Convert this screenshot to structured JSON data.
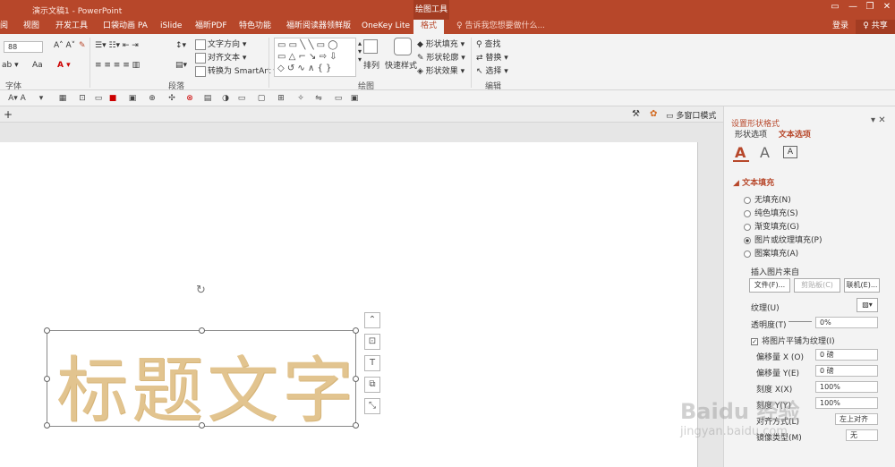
{
  "title_bar": {
    "title": "演示文稿1 - PowerPoint",
    "context_tool": "绘图工具",
    "buttons": [
      "▭",
      "—",
      "❐",
      "✕"
    ]
  },
  "tabs": [
    {
      "label": "阅"
    },
    {
      "label": "视图"
    },
    {
      "label": "开发工具"
    },
    {
      "label": "口袋动画 PA"
    },
    {
      "label": "iSlide"
    },
    {
      "label": "福昕PDF"
    },
    {
      "label": "特色功能"
    },
    {
      "label": "福昕阅读器领鲜版"
    },
    {
      "label": "OneKey Lite"
    },
    {
      "label": "格式"
    }
  ],
  "tell_me": "♀ 告诉我您想要做什么...",
  "login": "登录",
  "share": "♀ 共享",
  "ribbon": {
    "font_size": "88",
    "font_label": "字体",
    "paragraph_label": "段落",
    "text_direction": "文字方向",
    "align_text": "对齐文本",
    "convert_smartart": "转换为 SmartArt",
    "drawing_label": "绘图",
    "arrange": "排列",
    "quick_styles": "快速样式",
    "shape_fill": "形状填充",
    "shape_outline": "形状轮廓",
    "shape_effects": "形状效果",
    "find": "查找",
    "replace": "替换",
    "select": "选择",
    "editing_label": "编辑",
    "aa_label": "Aa"
  },
  "view_bar": {
    "multi_window": "多窗口模式"
  },
  "slide": {
    "title_text": "标题文字"
  },
  "pane": {
    "title": "设置形状格式",
    "tab_shape": "形状选项",
    "tab_text": "文本选项",
    "section": "文本填充",
    "options": [
      {
        "label": "无填充(N)",
        "selected": false
      },
      {
        "label": "纯色填充(S)",
        "selected": false
      },
      {
        "label": "渐变填充(G)",
        "selected": false
      },
      {
        "label": "图片或纹理填充(P)",
        "selected": true
      },
      {
        "label": "图案填充(A)",
        "selected": false
      }
    ],
    "insert_from": "插入图片来自",
    "file_btn": "文件(F)...",
    "clipboard_btn": "剪贴板(C)",
    "online_btn": "联机(E)...",
    "texture": "纹理(U)",
    "transparency": "透明度(T)",
    "transparency_value": "0%",
    "tile_checkbox": "将图片平铺为纹理(I)",
    "offset_x_label": "偏移量 X (O)",
    "offset_x_value": "0 磅",
    "offset_y_label": "偏移量 Y(E)",
    "offset_y_value": "0 磅",
    "scale_x_label": "刻度 X(X)",
    "scale_x_value": "100%",
    "scale_y_label": "刻度 Y(Y)",
    "scale_y_value": "100%",
    "align_label": "对齐方式(L)",
    "align_value": "左上对齐",
    "mirror_label": "镜像类型(M)",
    "mirror_value": "无"
  },
  "watermark": {
    "line1": "Baidu 经验",
    "line2": "jingyan.baidu.com"
  }
}
